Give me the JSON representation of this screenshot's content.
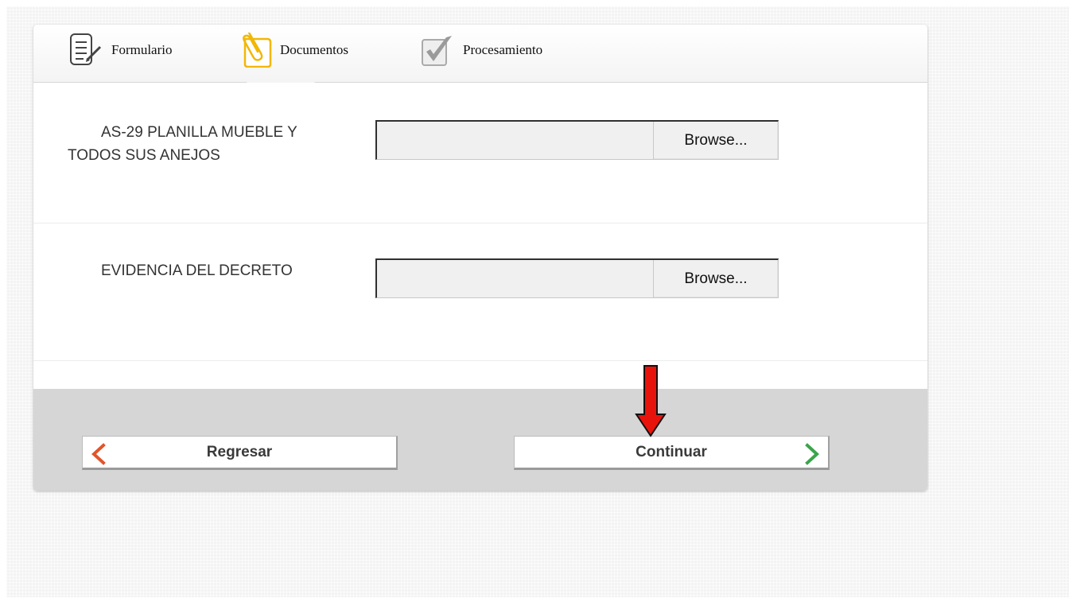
{
  "tabs": [
    {
      "label": "Formulario",
      "icon": "form-pencil-icon"
    },
    {
      "label": "Documentos",
      "icon": "paperclip-document-icon",
      "active": true
    },
    {
      "label": "Procesamiento",
      "icon": "checkmark-box-icon"
    }
  ],
  "documents": [
    {
      "label": "AS-29 PLANILLA MUEBLE Y TODOS SUS ANEJOS",
      "button_label": "Browse..."
    },
    {
      "label": "EVIDENCIA DEL DECRETO",
      "button_label": "Browse..."
    }
  ],
  "footer": {
    "back_label": "Regresar",
    "next_label": "Continuar"
  },
  "annotation": {
    "icon": "red-down-arrow",
    "color": "#e8140c"
  },
  "colors": {
    "back_chevron": "#e2552a",
    "next_chevron": "#3aa54a",
    "documents_icon": "#f2b705"
  }
}
